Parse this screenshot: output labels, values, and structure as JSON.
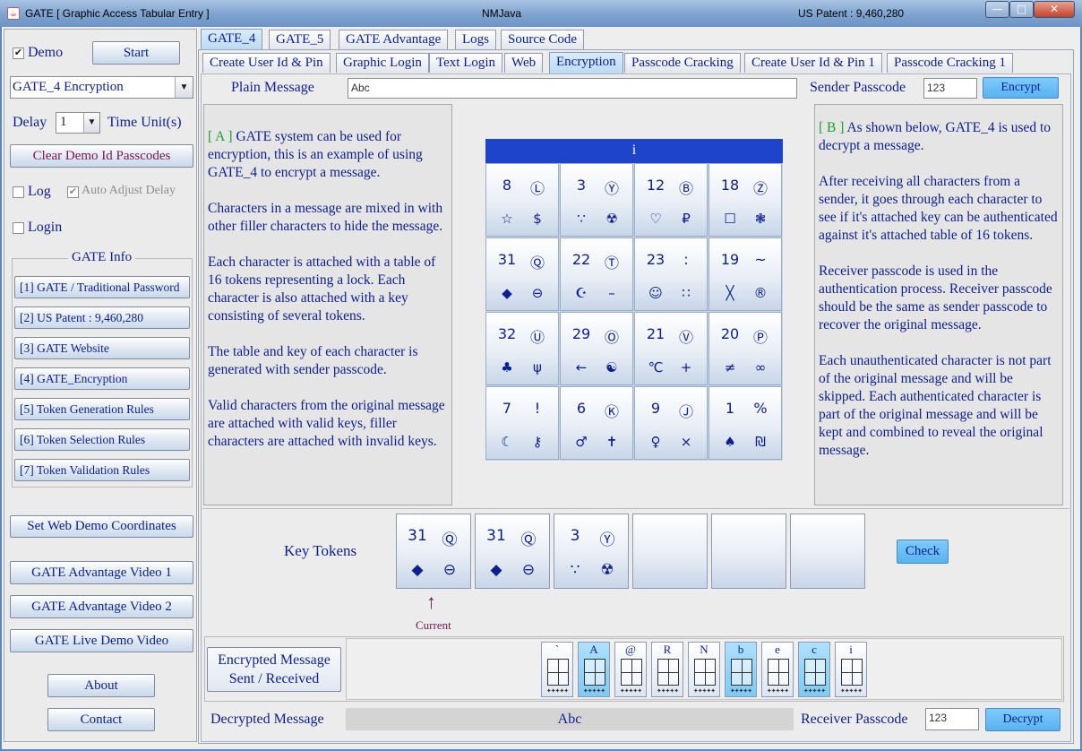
{
  "window": {
    "title": "GATE [ Graphic Access Tabular Entry ]",
    "center": "NMJava",
    "right": "US Patent : 9,460,280",
    "controls": [
      "—",
      "□",
      "✕"
    ]
  },
  "sidebar": {
    "demo_label": "Demo",
    "demo_checked": "✔",
    "start": "Start",
    "mode_select": "GATE_4 Encryption",
    "select_arrow": "▼",
    "delay_label": "Delay",
    "delay_value": "1",
    "time_unit": "Time Unit(s)",
    "clear": "Clear Demo Id Passcodes",
    "log": "Log",
    "auto_adjust": "Auto Adjust Delay",
    "auto_checked": "✔",
    "login": "Login",
    "info_title": "GATE Info",
    "info_items": [
      "[1] GATE / Traditional Password",
      "[2] US Patent : 9,460,280",
      "[3] GATE Website",
      "[4] GATE_Encryption",
      "[5] Token Generation Rules",
      "[6] Token Selection Rules",
      "[7] Token Validation Rules"
    ],
    "web_demo": "Set Web Demo Coordinates",
    "videos": [
      "GATE Advantage Video 1",
      "GATE Advantage Video 2",
      "GATE Live Demo Video"
    ],
    "about": "About",
    "contact": "Contact"
  },
  "tabs_top": [
    "GATE_4",
    "GATE_5",
    "GATE Advantage",
    "Logs",
    "Source Code"
  ],
  "tabs_sub": [
    "Create User Id & Pin",
    "Graphic Login",
    "Text Login",
    "Web",
    "Encryption",
    "Passcode Cracking",
    "Create User Id & Pin 1",
    "Passcode Cracking 1"
  ],
  "form": {
    "plain_label": "Plain Message",
    "plain_value": "Abc",
    "sender_label": "Sender Passcode",
    "sender_value": "123",
    "encrypt": "Encrypt"
  },
  "left_text": {
    "tag": "[ A ]",
    "body": " GATE system can be used for encryption, this is an example of using GATE_4 to encrypt a message.\n\nCharacters in a message are mixed in with other filler characters to hide the message.\n\nEach character is attached with a table of 16 tokens representing a lock. Each character is also attached with a key consisting of several tokens.\n\nThe table and key of each character is generated with sender passcode.\n\nValid characters from the original message are attached with valid keys, filler characters are attached with invalid keys."
  },
  "right_text": {
    "tag": "[ B ]",
    "body": " As shown below, GATE_4 is used to decrypt a message.\n\nAfter receiving all characters from a sender, it goes through each character to see if it's attached key can be authenticated against it's attached table of 16 tokens.\n\nReceiver passcode is used in the authentication process. Receiver passcode should be the same as sender passcode to recover the original message.\n\nEach unauthenticated character is not part of the original message and will be skipped. Each authenticated character is part of the original message and will be kept and combined to reveal the original message."
  },
  "grid": {
    "title": "i",
    "cells": [
      {
        "a": "8",
        "b": "Ⓛ",
        "c": "☆",
        "d": "$"
      },
      {
        "a": "3",
        "b": "Ⓨ",
        "c": "∵",
        "d": "☢"
      },
      {
        "a": "12",
        "b": "Ⓑ",
        "c": "♡",
        "d": "₽"
      },
      {
        "a": "18",
        "b": "Ⓩ",
        "c": "☐",
        "d": "❃"
      },
      {
        "a": "31",
        "b": "Ⓠ",
        "c": "◆",
        "d": "⊖"
      },
      {
        "a": "22",
        "b": "Ⓣ",
        "c": "☪",
        "d": "–"
      },
      {
        "a": "23",
        "b": ":",
        "c": "☺",
        "d": "∷"
      },
      {
        "a": "19",
        "b": "~",
        "c": "╳",
        "d": "®"
      },
      {
        "a": "32",
        "b": "Ⓤ",
        "c": "♣",
        "d": "ψ"
      },
      {
        "a": "29",
        "b": "Ⓞ",
        "c": "←",
        "d": "☯"
      },
      {
        "a": "21",
        "b": "Ⓥ",
        "c": "℃",
        "d": "+"
      },
      {
        "a": "20",
        "b": "Ⓟ",
        "c": "≠",
        "d": "∞"
      },
      {
        "a": "7",
        "b": "!",
        "c": "☾",
        "d": "⚷"
      },
      {
        "a": "6",
        "b": "Ⓚ",
        "c": "♂",
        "d": "✝"
      },
      {
        "a": "9",
        "b": "Ⓙ",
        "c": "♀",
        "d": "×"
      },
      {
        "a": "1",
        "b": "%",
        "c": "♠",
        "d": "₪"
      }
    ]
  },
  "key_tokens": {
    "label": "Key Tokens",
    "boxes": [
      {
        "a": "31",
        "b": "Ⓠ",
        "c": "◆",
        "d": "⊖"
      },
      {
        "a": "31",
        "b": "Ⓠ",
        "c": "◆",
        "d": "⊖"
      },
      {
        "a": "3",
        "b": "Ⓨ",
        "c": "∵",
        "d": "☢"
      },
      {
        "a": "",
        "b": "",
        "c": "",
        "d": ""
      },
      {
        "a": "",
        "b": "",
        "c": "",
        "d": ""
      },
      {
        "a": "",
        "b": "",
        "c": "",
        "d": ""
      }
    ],
    "check": "Check",
    "arrow": "↑",
    "current": "Current"
  },
  "encrypted": {
    "label_line1": "Encrypted Message",
    "label_line2": "Sent / Received",
    "chars": [
      {
        "ch": "`",
        "hl": false
      },
      {
        "ch": "A",
        "hl": true
      },
      {
        "ch": "@",
        "hl": false
      },
      {
        "ch": "R",
        "hl": false
      },
      {
        "ch": "N",
        "hl": false
      },
      {
        "ch": "b",
        "hl": true
      },
      {
        "ch": "e",
        "hl": false
      },
      {
        "ch": "c",
        "hl": true
      },
      {
        "ch": "i",
        "hl": false
      }
    ],
    "dots": "✦✦✦✦✦"
  },
  "decrypt": {
    "label": "Decrypted Message",
    "value": "Abc",
    "receiver_label": "Receiver Passcode",
    "receiver_value": "123",
    "button": "Decrypt"
  }
}
